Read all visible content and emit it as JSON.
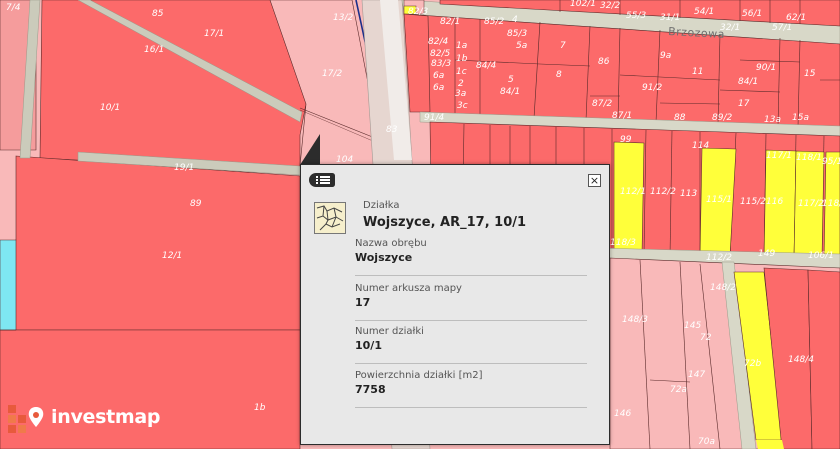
{
  "map": {
    "street_name": "Brzozowa",
    "parcel_labels": [
      "85",
      "17/1",
      "13/2",
      "10/1",
      "17/2",
      "89",
      "12/1",
      "1b",
      "7/4",
      "82/3",
      "82/1",
      "1a",
      "1b",
      "1c",
      "2",
      "3a",
      "3b",
      "3c",
      "4",
      "85/2",
      "85/3",
      "5a",
      "5",
      "84/4",
      "84/1",
      "82/4",
      "82/5",
      "83/3",
      "6a",
      "6a",
      "7",
      "8",
      "86",
      "87/2",
      "87/1",
      "9a",
      "11",
      "84/1",
      "90/1",
      "15",
      "17",
      "91/2",
      "88",
      "89/2",
      "13a",
      "15a",
      "91/4",
      "83",
      "104",
      "10/2",
      "99",
      "112/1",
      "112/2",
      "113",
      "114",
      "115/1",
      "115/2",
      "116",
      "117/1",
      "117/2",
      "118/1",
      "118/2",
      "118/3",
      "112/2",
      "148/2",
      "148/3",
      "145",
      "72",
      "147",
      "72a",
      "146",
      "70a",
      "72b",
      "148/4",
      "149",
      "106/1",
      "95/1",
      "102/1",
      "54/1",
      "56/1",
      "62/1",
      "57/1",
      "60/2",
      "55/3",
      "32/2",
      "31/1",
      "32/1",
      "33/1",
      "19/1",
      "16/1"
    ]
  },
  "popup": {
    "kind": "Działka",
    "title": "Wojszyce, AR_17, 10/1",
    "fields": [
      {
        "label": "Nazwa obrębu",
        "value": "Wojszyce"
      },
      {
        "label": "Numer arkusza mapy",
        "value": "17"
      },
      {
        "label": "Numer działki",
        "value": "10/1"
      },
      {
        "label": "Powierzchnia działki [m2]",
        "value": "7758"
      }
    ],
    "close_glyph": "×"
  },
  "brand": {
    "name": "investmap"
  },
  "colors": {
    "parcel_red": "#fc6a6a",
    "parcel_pink": "#f9b9b9",
    "parcel_yellow": "#ffff3a",
    "parcel_cyan": "#7ee7f2",
    "road": "#cbcbbb"
  }
}
